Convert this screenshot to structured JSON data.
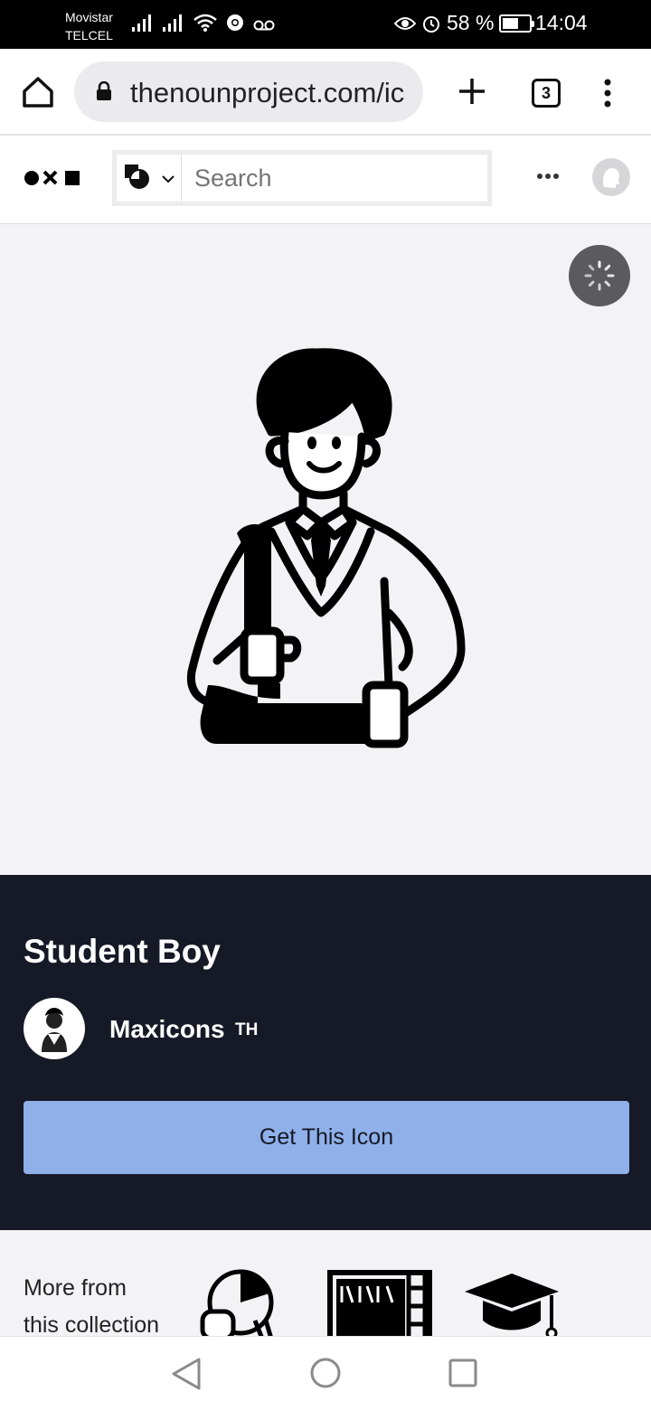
{
  "status_bar": {
    "carrier_line1": "Movistar",
    "carrier_line2": "TELCEL",
    "battery_percent": "58 %",
    "battery_level": 0.58,
    "time": "14:04"
  },
  "browser": {
    "url": "thenounproject.com/ic",
    "tab_count": "3"
  },
  "site_header": {
    "search_placeholder": "Search"
  },
  "icon": {
    "title": "Student Boy",
    "creator_name": "Maxicons",
    "creator_country": "TH",
    "get_button_label": "Get This Icon"
  },
  "more_section": {
    "label_line1": "More from",
    "label_line2": "this collection"
  },
  "colors": {
    "dark_panel": "#161926",
    "button_blue": "#8fb0e9",
    "preview_bg": "#f3f3f5"
  }
}
